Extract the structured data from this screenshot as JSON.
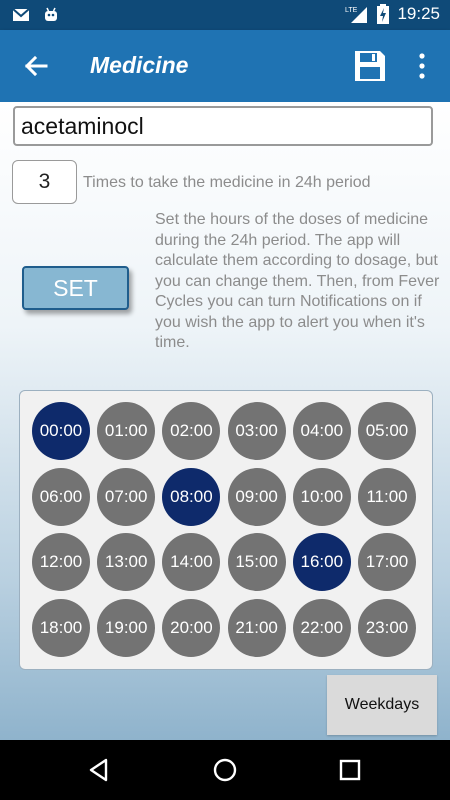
{
  "status_bar": {
    "time": "19:25",
    "network": "LTE",
    "icons": [
      "gmail-icon",
      "android-icon",
      "signal-icon",
      "battery-charging-icon"
    ]
  },
  "app_bar": {
    "title": "Medicine",
    "back_icon": "arrow-back-icon",
    "save_icon": "save-icon",
    "more_icon": "more-vert-icon"
  },
  "form": {
    "medicine_name": "acetaminocl",
    "times_value": "3",
    "times_label": "Times to take the medicine in 24h period",
    "set_label": "SET",
    "instructions": "Set the hours of the doses of medicine during the 24h period. The app will calculate them according to dosage, but you can change them. Then, from Fever Cycles you can turn Notifications on if you wish the app to alert you when it's time."
  },
  "hours": [
    {
      "label": "00:00",
      "selected": true
    },
    {
      "label": "01:00",
      "selected": false
    },
    {
      "label": "02:00",
      "selected": false
    },
    {
      "label": "03:00",
      "selected": false
    },
    {
      "label": "04:00",
      "selected": false
    },
    {
      "label": "05:00",
      "selected": false
    },
    {
      "label": "06:00",
      "selected": false
    },
    {
      "label": "07:00",
      "selected": false
    },
    {
      "label": "08:00",
      "selected": true
    },
    {
      "label": "09:00",
      "selected": false
    },
    {
      "label": "10:00",
      "selected": false
    },
    {
      "label": "11:00",
      "selected": false
    },
    {
      "label": "12:00",
      "selected": false
    },
    {
      "label": "13:00",
      "selected": false
    },
    {
      "label": "14:00",
      "selected": false
    },
    {
      "label": "15:00",
      "selected": false
    },
    {
      "label": "16:00",
      "selected": true
    },
    {
      "label": "17:00",
      "selected": false
    },
    {
      "label": "18:00",
      "selected": false
    },
    {
      "label": "19:00",
      "selected": false
    },
    {
      "label": "20:00",
      "selected": false
    },
    {
      "label": "21:00",
      "selected": false
    },
    {
      "label": "22:00",
      "selected": false
    },
    {
      "label": "23:00",
      "selected": false
    }
  ],
  "weekdays_label": "Weekdays",
  "colors": {
    "app_bar": "#1f73b3",
    "status_bar": "#0f4a78",
    "hour_selected": "#0e2a6b",
    "hour_default": "#737373"
  },
  "nav_bar": {
    "icons": [
      "back-triangle-icon",
      "home-circle-icon",
      "recents-square-icon"
    ]
  }
}
